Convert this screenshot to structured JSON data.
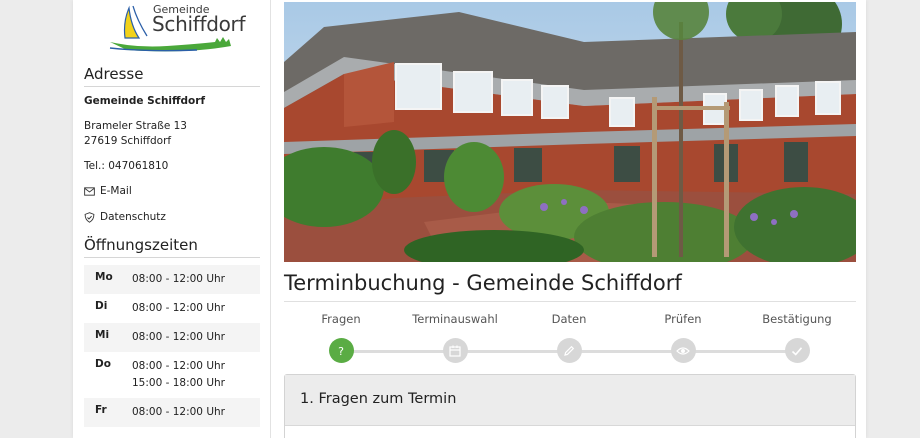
{
  "logo": {
    "line1": "Gemeinde",
    "line2": "Schiffdorf",
    "icon": "sailboat-logo"
  },
  "address": {
    "heading": "Adresse",
    "org": "Gemeinde Schiffdorf",
    "street": "Brameler Straße 13",
    "city": "27619 Schiffdorf",
    "phone": "Tel.: 047061810",
    "email_label": "E-Mail",
    "privacy_label": "Datenschutz"
  },
  "hours": {
    "heading": "Öffnungszeiten",
    "rows": [
      {
        "day": "Mo",
        "times": [
          "08:00 - 12:00 Uhr"
        ]
      },
      {
        "day": "Di",
        "times": [
          "08:00 - 12:00 Uhr"
        ]
      },
      {
        "day": "Mi",
        "times": [
          "08:00 - 12:00 Uhr"
        ]
      },
      {
        "day": "Do",
        "times": [
          "08:00 - 12:00 Uhr",
          "15:00 - 18:00 Uhr"
        ]
      },
      {
        "day": "Fr",
        "times": [
          "08:00 - 12:00 Uhr"
        ]
      }
    ]
  },
  "main": {
    "title": "Terminbuchung - Gemeinde Schiffdorf",
    "steps": [
      {
        "label": "Fragen",
        "icon": "question-icon",
        "active": true
      },
      {
        "label": "Terminauswahl",
        "icon": "calendar-icon",
        "active": false
      },
      {
        "label": "Daten",
        "icon": "pencil-icon",
        "active": false
      },
      {
        "label": "Prüfen",
        "icon": "eye-icon",
        "active": false
      },
      {
        "label": "Bestätigung",
        "icon": "check-icon",
        "active": false
      }
    ],
    "panel_title": "1. Fragen zum Termin"
  },
  "colors": {
    "active_step": "#5aac44",
    "inactive_step": "#d7d7d7",
    "logo_green": "#4aa83a",
    "logo_yellow": "#f2d21b",
    "logo_blue": "#2b5fa8"
  }
}
